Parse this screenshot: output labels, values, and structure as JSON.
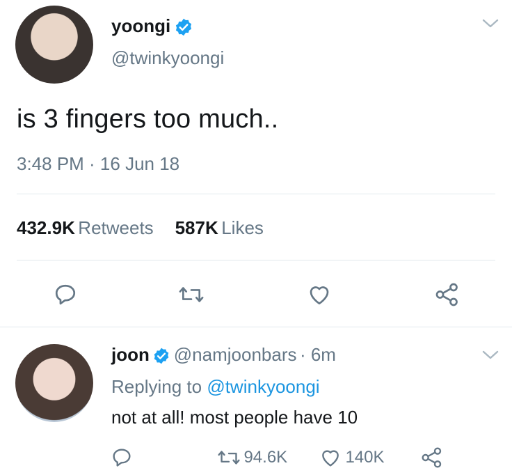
{
  "tweet": {
    "display_name": "yoongi",
    "handle": "@twinkyoongi",
    "text": "is 3 fingers too much..",
    "timestamp": "3:48 PM · 16 Jun 18",
    "retweets_count": "432.9K",
    "retweets_label": "Retweets",
    "likes_count": "587K",
    "likes_label": "Likes"
  },
  "reply": {
    "display_name": "joon",
    "handle": "@namjoonbars",
    "time": "· 6m",
    "replying_prefix": "Replying to",
    "replying_handle": "@twinkyoongi",
    "text": "not at all! most people have 10",
    "retweet_count": "94.6K",
    "like_count": "140K"
  },
  "icons": {
    "verified": "verified-badge-icon",
    "chevron": "chevron-down-icon",
    "reply": "reply-icon",
    "retweet": "retweet-icon",
    "like": "heart-icon",
    "share": "share-icon"
  },
  "colors": {
    "accent": "#1da1f2",
    "secondary_text": "#657786",
    "divider": "#e1e8ed"
  }
}
